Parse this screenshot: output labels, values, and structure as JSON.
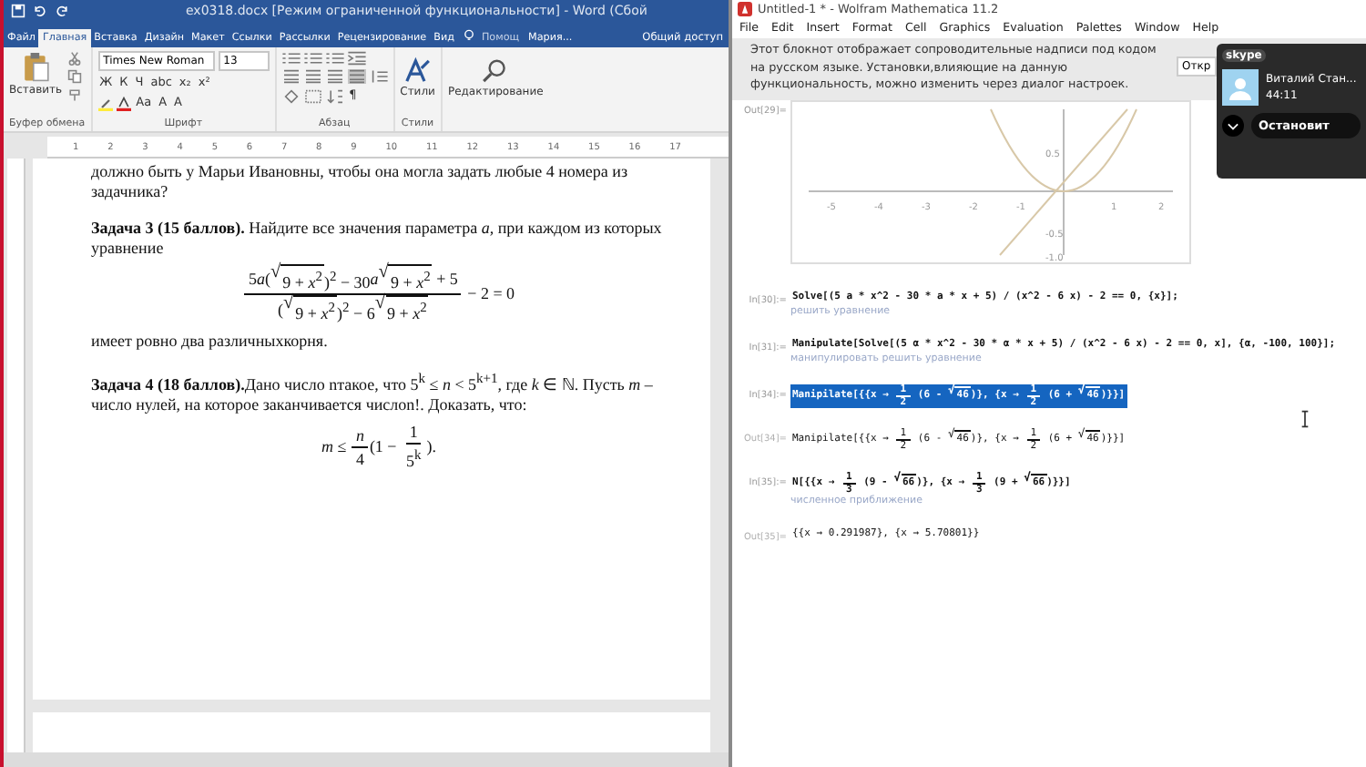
{
  "word": {
    "title": "ex0318.docx [Режим ограниченной функциональности] - Word (Сбой",
    "tabs": [
      {
        "label": "Файл",
        "selected": false
      },
      {
        "label": "Главная",
        "selected": true
      },
      {
        "label": "Вставка",
        "selected": false
      },
      {
        "label": "Дизайн",
        "selected": false
      },
      {
        "label": "Макет",
        "selected": false
      },
      {
        "label": "Ссылки",
        "selected": false
      },
      {
        "label": "Рассылки",
        "selected": false
      },
      {
        "label": "Рецензирование",
        "selected": false
      },
      {
        "label": "Вид",
        "selected": false
      }
    ],
    "help": "Помощ",
    "user": "Мария...",
    "share": "Общий доступ",
    "paste": "Вставить",
    "font_name": "Times New Roman",
    "font_size": "13",
    "font_buttons": [
      "Ж",
      "К",
      "Ч",
      "abc",
      "x₂",
      "x²"
    ],
    "font_buttons_2": [
      "Aa",
      "A",
      "A"
    ],
    "pilcrow": "¶",
    "styles": "Стили",
    "editing": "Редактирование",
    "group_labels": [
      "Буфер обмена",
      "Шрифт",
      "Абзац",
      "Стили"
    ],
    "ruler": [
      "1",
      "2",
      "3",
      "4",
      "5",
      "6",
      "7",
      "8",
      "9",
      "10",
      "11",
      "12",
      "13",
      "14",
      "15",
      "16",
      "17"
    ],
    "paragraphs": [
      {
        "kind": "text",
        "text": "должно быть у Марьи Ивановны, чтобы она могла задать любые 4 номера из задачника?"
      },
      {
        "kind": "text",
        "text": "**Задача 3 (15 баллов).** Найдите все значения параметра *a*, при каждом из которых уравнение"
      },
      {
        "kind": "math",
        "tokens": [
          {
            "kind": "frac",
            "num": [
              {
                "kind": "t",
                "text": "5"
              },
              {
                "kind": "t",
                "text": "*a*"
              },
              {
                "kind": "t",
                "text": "("
              },
              {
                "kind": "sqrt",
                "sign": "√",
                "text": "9 + *x*$^{2}$"
              },
              {
                "kind": "t",
                "text": ")$^{2}$ − 30"
              },
              {
                "kind": "t",
                "text": "*a*"
              },
              {
                "kind": "sqrt",
                "sign": "√",
                "text": "9 + *x*$^{2}$"
              },
              {
                "kind": "t",
                "text": " + 5"
              }
            ],
            "den": [
              {
                "kind": "t",
                "text": "("
              },
              {
                "kind": "sqrt",
                "sign": "√",
                "text": "9 + *x*$^{2}$"
              },
              {
                "kind": "t",
                "text": ")$^{2}$ − 6"
              },
              {
                "kind": "sqrt",
                "sign": "√",
                "text": "9 + *x*$^{2}$"
              }
            ]
          },
          {
            "kind": "t",
            "text": " − 2 = 0"
          }
        ]
      },
      {
        "kind": "text",
        "text": "имеет ровно два различныхкорня."
      },
      {
        "kind": "text",
        "text": "**Задача 4 (18 баллов).**Дано число nтакое, что 5$^{k}$ ≤ *n* < 5$^{k+1}$, где *k* ∈ ℕ. Пусть *m* – число нулей, на которое заканчивается числоn!. Доказать, что:"
      },
      {
        "kind": "math",
        "tokens": [
          {
            "kind": "t",
            "text": "*m* ≤ "
          },
          {
            "kind": "frac",
            "num": [
              {
                "kind": "t",
                "text": "*n*"
              }
            ],
            "den": [
              {
                "kind": "t",
                "text": "4"
              }
            ]
          },
          {
            "kind": "t",
            "text": "(1 − "
          },
          {
            "kind": "frac",
            "num": [
              {
                "kind": "t",
                "text": "1"
              }
            ],
            "den": [
              {
                "kind": "t",
                "text": "5$^{k}$"
              }
            ]
          },
          {
            "kind": "t",
            "text": ")."
          }
        ]
      }
    ]
  },
  "mathematica": {
    "title": "Untitled-1 * - Wolfram Mathematica 11.2",
    "menu": [
      "File",
      "Edit",
      "Insert",
      "Format",
      "Cell",
      "Graphics",
      "Evaluation",
      "Palettes",
      "Window",
      "Help"
    ],
    "notice": "Этот блокнот отображает сопроводительные надписи под кодом на русском языке. Установки,влияющие на данную функциональность, можно изменить через диалог настроек.",
    "notice_button": "Откр",
    "plot_label": "Out[29]=",
    "plot": {
      "x_ticks": [
        "-5",
        "-4",
        "-3",
        "-2",
        "-1",
        "1",
        "2"
      ],
      "y_ticks": [
        "0.5",
        "-0.5",
        "-1.0"
      ]
    },
    "cells": [
      {
        "kind": "input",
        "label": "In[30]:=",
        "selected": false,
        "hint": "решить уравнение",
        "tokens": [
          {
            "kind": "t",
            "text": "Solve[(5 a * x^2 - 30 * a * x + 5) / (x^2 - 6 x) - 2 == 0, {x}];"
          }
        ]
      },
      {
        "kind": "input",
        "label": "In[31]:=",
        "selected": false,
        "hint": "манипулировать  решить уравнение",
        "tokens": [
          {
            "kind": "t",
            "text": "Manipulate[Solve[(5 α * x^2 - 30 * α * x + 5) / (x^2 - 6 x) - 2 == 0, x], {α, -100, 100}];"
          }
        ]
      },
      {
        "kind": "input",
        "label": "In[34]:=",
        "selected": true,
        "tokens": [
          {
            "kind": "t",
            "text": "Manipilate[{{x → "
          },
          {
            "kind": "frac",
            "num": [
              {
                "kind": "t",
                "text": "1"
              }
            ],
            "den": [
              {
                "kind": "t",
                "text": "2"
              }
            ]
          },
          {
            "kind": "t",
            "text": " (6 - "
          },
          {
            "kind": "sqrt",
            "sign": "√",
            "text": "46"
          },
          {
            "kind": "t",
            "text": ")}, {x → "
          },
          {
            "kind": "frac",
            "num": [
              {
                "kind": "t",
                "text": "1"
              }
            ],
            "den": [
              {
                "kind": "t",
                "text": "2"
              }
            ]
          },
          {
            "kind": "t",
            "text": " (6 + "
          },
          {
            "kind": "sqrt",
            "sign": "√",
            "text": "46"
          },
          {
            "kind": "t",
            "text": ")}}]"
          }
        ]
      },
      {
        "kind": "output",
        "label": "Out[34]=",
        "selected": false,
        "tokens": [
          {
            "kind": "t",
            "text": "Manipilate[{{x → "
          },
          {
            "kind": "frac",
            "num": [
              {
                "kind": "t",
                "text": "1"
              }
            ],
            "den": [
              {
                "kind": "t",
                "text": "2"
              }
            ]
          },
          {
            "kind": "t",
            "text": " (6 - "
          },
          {
            "kind": "sqrt",
            "sign": "√",
            "text": "46"
          },
          {
            "kind": "t",
            "text": ")}, {x → "
          },
          {
            "kind": "frac",
            "num": [
              {
                "kind": "t",
                "text": "1"
              }
            ],
            "den": [
              {
                "kind": "t",
                "text": "2"
              }
            ]
          },
          {
            "kind": "t",
            "text": " (6 + "
          },
          {
            "kind": "sqrt",
            "sign": "√",
            "text": "46"
          },
          {
            "kind": "t",
            "text": ")}}]"
          }
        ]
      },
      {
        "kind": "input",
        "label": "In[35]:=",
        "selected": false,
        "hint": "численное приближение",
        "tokens": [
          {
            "kind": "t",
            "text": "N[{{x → "
          },
          {
            "kind": "frac",
            "num": [
              {
                "kind": "t",
                "text": "1"
              }
            ],
            "den": [
              {
                "kind": "t",
                "text": "3"
              }
            ]
          },
          {
            "kind": "t",
            "text": " (9 - "
          },
          {
            "kind": "sqrt",
            "sign": "√",
            "text": "66"
          },
          {
            "kind": "t",
            "text": ")}, {x → "
          },
          {
            "kind": "frac",
            "num": [
              {
                "kind": "t",
                "text": "1"
              }
            ],
            "den": [
              {
                "kind": "t",
                "text": "3"
              }
            ]
          },
          {
            "kind": "t",
            "text": " (9 + "
          },
          {
            "kind": "sqrt",
            "sign": "√",
            "text": "66"
          },
          {
            "kind": "t",
            "text": ")}}]"
          }
        ]
      },
      {
        "kind": "output",
        "label": "Out[35]=",
        "selected": false,
        "tokens": [
          {
            "kind": "t",
            "text": "{{x → 0.291987}, {x → 5.70801}}"
          }
        ]
      }
    ]
  },
  "skype": {
    "logo": "skype",
    "caller": "Виталий Стан...",
    "duration": "44:11",
    "stop": "Остановит"
  }
}
